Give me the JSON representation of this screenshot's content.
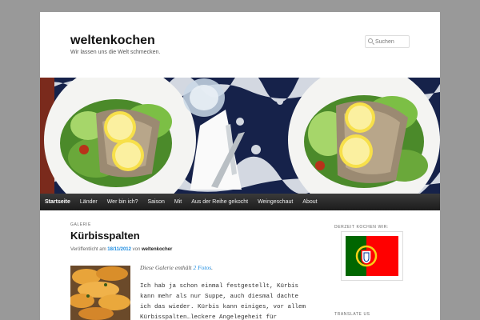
{
  "site": {
    "title": "weltenkochen",
    "description": "Wir lassen uns die Welt schmecken."
  },
  "search": {
    "placeholder": "Suchen"
  },
  "nav": {
    "items": [
      "Startseite",
      "Länder",
      "Wer bin ich?",
      "Saison",
      "Mit",
      "Aus der Reihe gekocht",
      "Weingeschaut",
      "About"
    ],
    "active": "Startseite"
  },
  "post": {
    "category": "GALERIE",
    "title": "Kürbisspalten",
    "meta_prefix": "Veröffentlicht am",
    "date": "18/11/2012",
    "meta_by": "von",
    "author": "weltenkocher",
    "gallery_note_prefix": "Diese Galerie enthält",
    "gallery_note_link": "2 Fotos",
    "gallery_note_suffix": ".",
    "body": "Ich hab ja schon einmal festgestellt, Kürbis kann mehr als nur Suppe, auch diesmal dachte ich das wieder. Kürbis kann einiges, vor allem Kürbisspalten…leckere Angelegeheit für"
  },
  "sidebar": {
    "widget1_title": "DERZEIT KOCHEN WIR:",
    "widget2_title": "TRANSLATE US"
  },
  "colors": {
    "page_bg": "#999999",
    "nav_bg": "#222222",
    "link": "#1b8be0",
    "flag_green": "#006600",
    "flag_red": "#ff0000"
  }
}
